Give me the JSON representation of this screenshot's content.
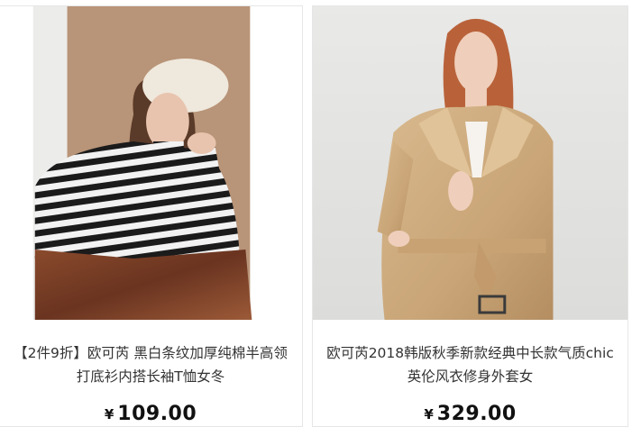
{
  "products": [
    {
      "title_line1": "【2件9折】欧可芮 黑白条纹加厚纯棉半高领",
      "title_line2": "打底衫内搭长袖T恤女冬",
      "currency": "¥",
      "price": "109.00",
      "image": "model-striped-turtleneck-beret"
    },
    {
      "title_line1": "欧可芮2018韩版秋季新款经典中长款气质chic",
      "title_line2": "英伦风衣修身外套女",
      "currency": "¥",
      "price": "329.00",
      "image": "model-beige-trench-coat"
    }
  ]
}
